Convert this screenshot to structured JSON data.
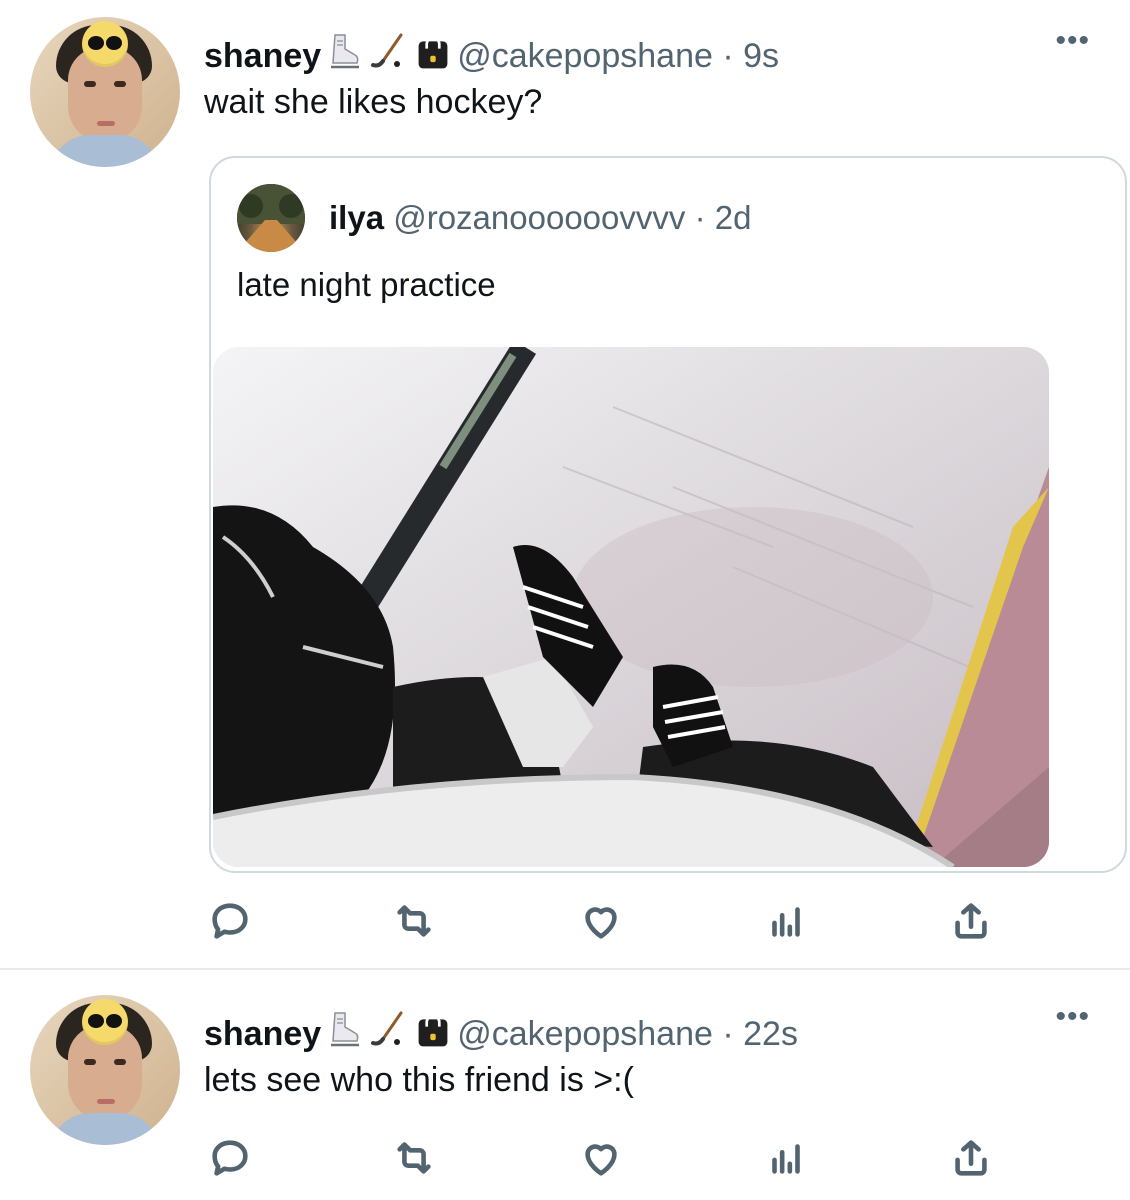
{
  "tweets": [
    {
      "name": "shaney",
      "badges": [
        "ice-skate-emoji",
        "hockey-stick-emoji",
        "lock-icon"
      ],
      "handle": "@cakepopshane",
      "separator": "·",
      "time": "9s",
      "more": "•••",
      "text": "wait she likes hockey?",
      "quote": {
        "name": "ilya",
        "handle": "@rozanoooooovvvv",
        "separator": "·",
        "time": "2d",
        "text": "late night practice",
        "media": "ice-rink-photo"
      }
    },
    {
      "name": "shaney",
      "badges": [
        "ice-skate-emoji",
        "hockey-stick-emoji",
        "lock-icon"
      ],
      "handle": "@cakepopshane",
      "separator": "·",
      "time": "22s",
      "more": "•••",
      "text": "lets see who this friend is >:("
    }
  ],
  "action_icons": [
    "reply-icon",
    "retweet-icon",
    "like-icon",
    "views-icon",
    "share-icon"
  ]
}
